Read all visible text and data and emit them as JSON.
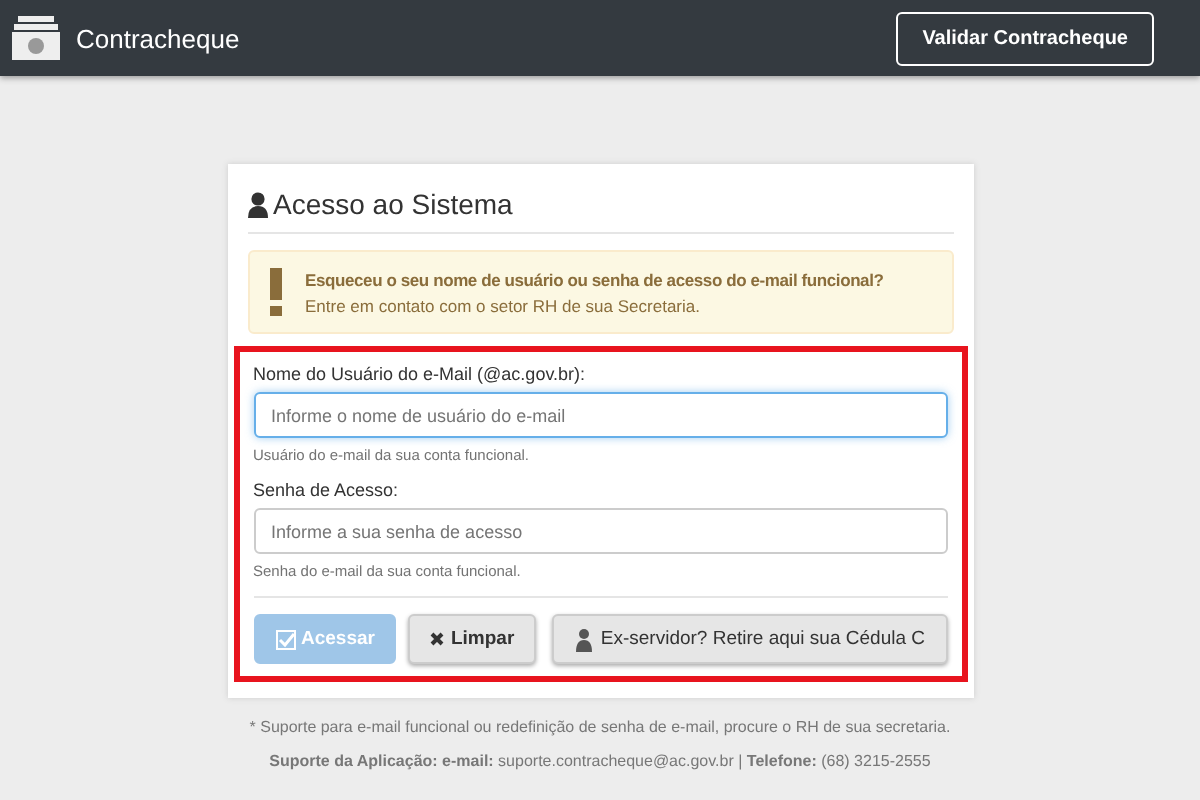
{
  "header": {
    "brand": "Contracheque",
    "validate_button": "Validar Contracheque"
  },
  "login": {
    "title": "Acesso ao Sistema",
    "alert": {
      "heading": "Esqueceu o seu nome de usuário ou senha de acesso do e-mail funcional?",
      "text": "Entre em contato com o setor RH de sua Secretaria."
    },
    "fields": [
      {
        "label": "Nome do Usuário do e-Mail (@ac.gov.br):",
        "placeholder": "Informe o nome de usuário do e-mail",
        "help": "Usuário do e-mail da sua conta funcional.",
        "focused": true
      },
      {
        "label": "Senha de Acesso:",
        "placeholder": "Informe a sua senha de acesso",
        "help": "Senha do e-mail da sua conta funcional.",
        "focused": false
      }
    ],
    "buttons": [
      {
        "kind": "submit",
        "label": "Acessar",
        "disabled": true
      },
      {
        "kind": "clear",
        "label": "Limpar",
        "disabled": false
      },
      {
        "kind": "former",
        "label": "Ex-servidor? Retire aqui sua Cédula C",
        "disabled": false
      }
    ]
  },
  "footer": [
    "* Suporte para e-mail funcional ou redefinição de senha de e-mail, procure o RH de sua secretaria.",
    "**Suporte da Aplicação: e-mail:** suporte.contracheque@ac.gov.br | **Telefone:** (68) 3215-2555"
  ]
}
